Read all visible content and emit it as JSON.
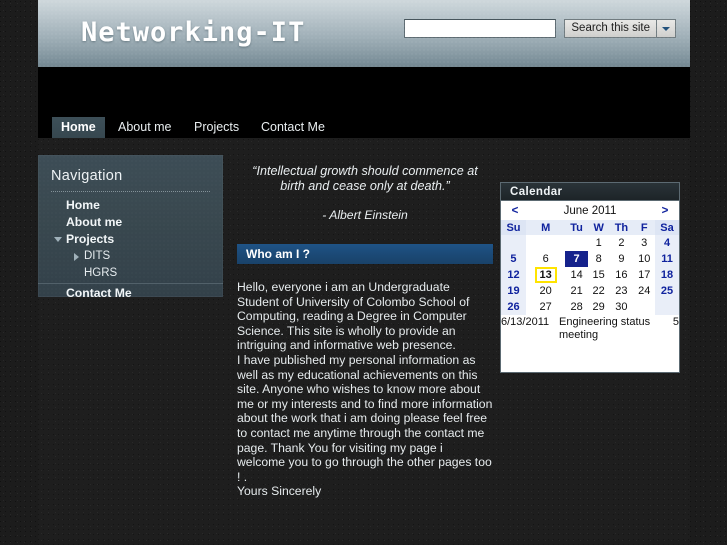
{
  "header": {
    "site_title": "Networking-IT",
    "search": {
      "value": "",
      "placeholder": "",
      "submit_label": "Search this site",
      "dropdown_icon": "caret-down-icon"
    }
  },
  "tabs": [
    {
      "label": "Home",
      "active": true
    },
    {
      "label": "About me",
      "active": false
    },
    {
      "label": "Projects",
      "active": false
    },
    {
      "label": "Contact Me",
      "active": false
    }
  ],
  "sidebar": {
    "title": "Navigation",
    "items": [
      {
        "label": "Home",
        "level": 0,
        "chevron": ""
      },
      {
        "label": "About me",
        "level": 0,
        "chevron": ""
      },
      {
        "label": "Projects",
        "level": 0,
        "chevron": "down"
      },
      {
        "label": "DITS",
        "level": 1,
        "chevron": "right"
      },
      {
        "label": "HGRS",
        "level": 1,
        "chevron": ""
      },
      {
        "label": "Contact Me",
        "level": 0,
        "chevron": "",
        "rule_above": true
      }
    ]
  },
  "main": {
    "quote": "“Intellectual growth should commence at birth and cease only at death.”",
    "quote_author": "- Albert Einstein",
    "section_title": "Who am I ?",
    "paragraph_1": "Hello, everyone i am an Undergraduate Student of University of Colombo School of Computing, reading a Degree in Computer Science. This site is wholly to provide an intriguing and informative web presence.",
    "paragraph_2": "I have published my personal information as well as my educational achievements on this site. Anyone who wishes to know more about me or my interests and to find more information about the work that i am doing please feel free to contact me anytime through the contact me page. Thank You for visiting my page i welcome you to go through the other pages too ! .",
    "signoff": "Yours Sincerely"
  },
  "calendar": {
    "widget_title": "Calendar",
    "prev_label": "<",
    "next_label": ">",
    "month_label": "June 2011",
    "weekday_headers": [
      "Su",
      "M",
      "Tu",
      "W",
      "Th",
      "F",
      "Sa"
    ],
    "weeks": [
      [
        {
          "day": "",
          "weekend": true,
          "selected": false,
          "today": false
        },
        {
          "day": "",
          "weekend": false,
          "selected": false,
          "today": false
        },
        {
          "day": "",
          "weekend": false,
          "selected": false,
          "today": false
        },
        {
          "day": "1",
          "weekend": false,
          "selected": false,
          "today": false
        },
        {
          "day": "2",
          "weekend": false,
          "selected": false,
          "today": false
        },
        {
          "day": "3",
          "weekend": false,
          "selected": false,
          "today": false
        },
        {
          "day": "4",
          "weekend": true,
          "selected": false,
          "today": false
        }
      ],
      [
        {
          "day": "5",
          "weekend": true,
          "selected": false,
          "today": false
        },
        {
          "day": "6",
          "weekend": false,
          "selected": false,
          "today": false
        },
        {
          "day": "7",
          "weekend": false,
          "selected": true,
          "today": false
        },
        {
          "day": "8",
          "weekend": false,
          "selected": false,
          "today": false
        },
        {
          "day": "9",
          "weekend": false,
          "selected": false,
          "today": false
        },
        {
          "day": "10",
          "weekend": false,
          "selected": false,
          "today": false
        },
        {
          "day": "11",
          "weekend": true,
          "selected": false,
          "today": false
        }
      ],
      [
        {
          "day": "12",
          "weekend": true,
          "selected": false,
          "today": false
        },
        {
          "day": "13",
          "weekend": false,
          "selected": false,
          "today": true
        },
        {
          "day": "14",
          "weekend": false,
          "selected": false,
          "today": false
        },
        {
          "day": "15",
          "weekend": false,
          "selected": false,
          "today": false
        },
        {
          "day": "16",
          "weekend": false,
          "selected": false,
          "today": false
        },
        {
          "day": "17",
          "weekend": false,
          "selected": false,
          "today": false
        },
        {
          "day": "18",
          "weekend": true,
          "selected": false,
          "today": false
        }
      ],
      [
        {
          "day": "19",
          "weekend": true,
          "selected": false,
          "today": false
        },
        {
          "day": "20",
          "weekend": false,
          "selected": false,
          "today": false
        },
        {
          "day": "21",
          "weekend": false,
          "selected": false,
          "today": false
        },
        {
          "day": "22",
          "weekend": false,
          "selected": false,
          "today": false
        },
        {
          "day": "23",
          "weekend": false,
          "selected": false,
          "today": false
        },
        {
          "day": "24",
          "weekend": false,
          "selected": false,
          "today": false
        },
        {
          "day": "25",
          "weekend": true,
          "selected": false,
          "today": false
        }
      ],
      [
        {
          "day": "26",
          "weekend": true,
          "selected": false,
          "today": false
        },
        {
          "day": "27",
          "weekend": false,
          "selected": false,
          "today": false
        },
        {
          "day": "28",
          "weekend": false,
          "selected": false,
          "today": false
        },
        {
          "day": "29",
          "weekend": false,
          "selected": false,
          "today": false
        },
        {
          "day": "30",
          "weekend": false,
          "selected": false,
          "today": false
        },
        {
          "day": "",
          "weekend": false,
          "selected": false,
          "today": false
        },
        {
          "day": "",
          "weekend": true,
          "selected": false,
          "today": false
        }
      ]
    ],
    "events": [
      {
        "date": "6/13/2011",
        "title": "Engineering status meeting",
        "count": "5"
      }
    ]
  },
  "colors": {
    "banner_top": "#cfd8dc",
    "banner_bottom": "#73868f",
    "sidebar_bg": "#39484f",
    "section_bar": "#1b4975",
    "calendar_selected": "#15228c",
    "calendar_today_outline": "#ffe400",
    "calendar_weekend": "#e9eef8",
    "accent_blue": "#10239e",
    "page_bg": "#1e1e1e"
  }
}
